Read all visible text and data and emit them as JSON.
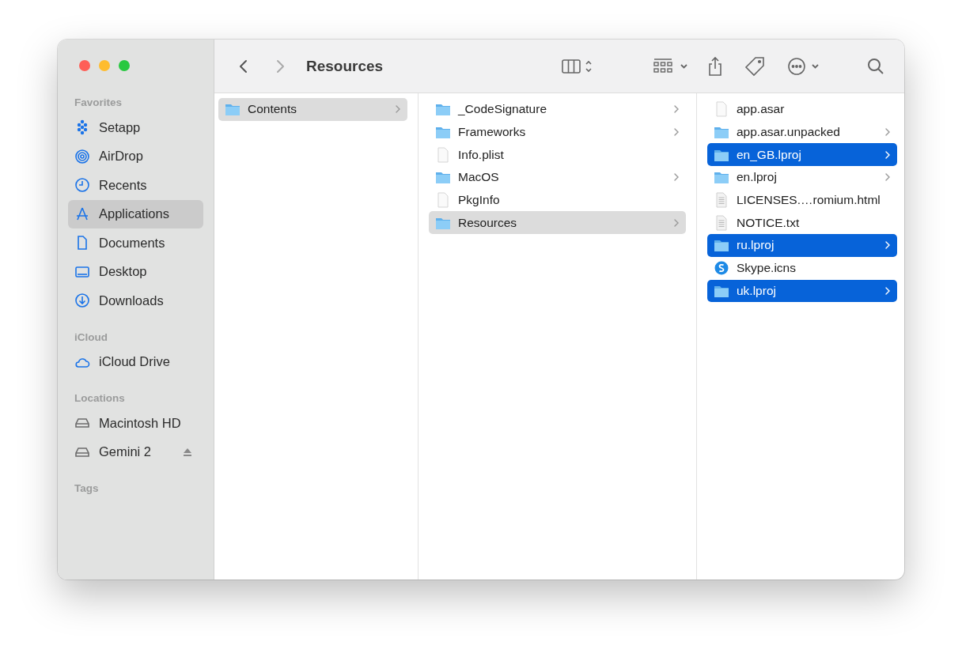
{
  "window": {
    "title": "Resources"
  },
  "sidebar": {
    "sections": [
      {
        "title": "Favorites",
        "items": [
          {
            "label": "Setapp",
            "selected": false
          },
          {
            "label": "AirDrop",
            "selected": false
          },
          {
            "label": "Recents",
            "selected": false
          },
          {
            "label": "Applications",
            "selected": true
          },
          {
            "label": "Documents",
            "selected": false
          },
          {
            "label": "Desktop",
            "selected": false
          },
          {
            "label": "Downloads",
            "selected": false
          }
        ]
      },
      {
        "title": "iCloud",
        "items": [
          {
            "label": "iCloud Drive",
            "selected": false
          }
        ]
      },
      {
        "title": "Locations",
        "items": [
          {
            "label": "Macintosh HD",
            "selected": false,
            "ejectable": false
          },
          {
            "label": "Gemini 2",
            "selected": false,
            "ejectable": true
          }
        ]
      },
      {
        "title": "Tags"
      }
    ]
  },
  "columns": [
    {
      "focused": false,
      "items": [
        {
          "name": "Contents",
          "kind": "folder",
          "has_children": true,
          "selected": true
        }
      ]
    },
    {
      "focused": false,
      "items": [
        {
          "name": "_CodeSignature",
          "kind": "folder",
          "has_children": true,
          "selected": false
        },
        {
          "name": "Frameworks",
          "kind": "folder",
          "has_children": true,
          "selected": false
        },
        {
          "name": "Info.plist",
          "kind": "file",
          "has_children": false,
          "selected": false
        },
        {
          "name": "MacOS",
          "kind": "folder",
          "has_children": true,
          "selected": false
        },
        {
          "name": "PkgInfo",
          "kind": "file",
          "has_children": false,
          "selected": false
        },
        {
          "name": "Resources",
          "kind": "folder",
          "has_children": true,
          "selected": true
        }
      ]
    },
    {
      "focused": true,
      "items": [
        {
          "name": "app.asar",
          "kind": "file",
          "has_children": false,
          "selected": false
        },
        {
          "name": "app.asar.unpacked",
          "kind": "folder",
          "has_children": true,
          "selected": false
        },
        {
          "name": "en_GB.lproj",
          "kind": "folder",
          "has_children": true,
          "selected": true
        },
        {
          "name": "en.lproj",
          "kind": "folder",
          "has_children": true,
          "selected": false
        },
        {
          "name": "LICENSES.…romium.html",
          "kind": "document",
          "has_children": false,
          "selected": false
        },
        {
          "name": "NOTICE.txt",
          "kind": "document",
          "has_children": false,
          "selected": false
        },
        {
          "name": "ru.lproj",
          "kind": "folder",
          "has_children": true,
          "selected": true
        },
        {
          "name": "Skype.icns",
          "kind": "app",
          "has_children": false,
          "selected": false
        },
        {
          "name": "uk.lproj",
          "kind": "folder",
          "has_children": true,
          "selected": true
        }
      ]
    }
  ]
}
